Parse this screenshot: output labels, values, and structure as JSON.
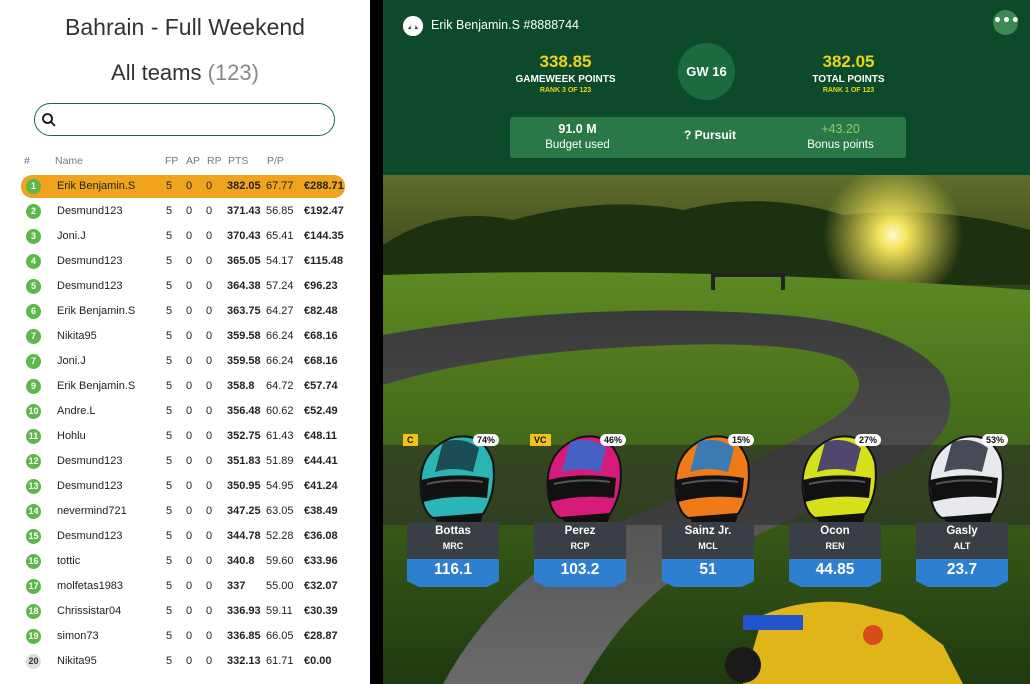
{
  "left": {
    "title": "Bahrain - Full Weekend",
    "subtitle": "All teams",
    "subtitle_count": "(123)",
    "search_placeholder": "",
    "columns": {
      "rank": "#",
      "name": "Name",
      "fp": "FP",
      "ap": "AP",
      "rp": "RP",
      "pts": "PTS",
      "pp": "P/P"
    },
    "rows": [
      {
        "rank": "1",
        "name": "Erik Benjamin.S",
        "fp": "5",
        "ap": "0",
        "rp": "0",
        "pts": "382.05",
        "pp": "67.77",
        "prize": "€288.71",
        "me": true
      },
      {
        "rank": "2",
        "name": "Desmund123",
        "fp": "5",
        "ap": "0",
        "rp": "0",
        "pts": "371.43",
        "pp": "56.85",
        "prize": "€192.47"
      },
      {
        "rank": "3",
        "name": "Joni.J",
        "fp": "5",
        "ap": "0",
        "rp": "0",
        "pts": "370.43",
        "pp": "65.41",
        "prize": "€144.35"
      },
      {
        "rank": "4",
        "name": "Desmund123",
        "fp": "5",
        "ap": "0",
        "rp": "0",
        "pts": "365.05",
        "pp": "54.17",
        "prize": "€115.48"
      },
      {
        "rank": "5",
        "name": "Desmund123",
        "fp": "5",
        "ap": "0",
        "rp": "0",
        "pts": "364.38",
        "pp": "57.24",
        "prize": "€96.23"
      },
      {
        "rank": "6",
        "name": "Erik Benjamin.S",
        "fp": "5",
        "ap": "0",
        "rp": "0",
        "pts": "363.75",
        "pp": "64.27",
        "prize": "€82.48"
      },
      {
        "rank": "7",
        "name": "Nikita95",
        "fp": "5",
        "ap": "0",
        "rp": "0",
        "pts": "359.58",
        "pp": "66.24",
        "prize": "€68.16"
      },
      {
        "rank": "7",
        "name": "Joni.J",
        "fp": "5",
        "ap": "0",
        "rp": "0",
        "pts": "359.58",
        "pp": "66.24",
        "prize": "€68.16"
      },
      {
        "rank": "9",
        "name": "Erik Benjamin.S",
        "fp": "5",
        "ap": "0",
        "rp": "0",
        "pts": "358.8",
        "pp": "64.72",
        "prize": "€57.74"
      },
      {
        "rank": "10",
        "name": "Andre.L",
        "fp": "5",
        "ap": "0",
        "rp": "0",
        "pts": "356.48",
        "pp": "60.62",
        "prize": "€52.49"
      },
      {
        "rank": "11",
        "name": "Hohlu",
        "fp": "5",
        "ap": "0",
        "rp": "0",
        "pts": "352.75",
        "pp": "61.43",
        "prize": "€48.11"
      },
      {
        "rank": "12",
        "name": "Desmund123",
        "fp": "5",
        "ap": "0",
        "rp": "0",
        "pts": "351.83",
        "pp": "51.89",
        "prize": "€44.41"
      },
      {
        "rank": "13",
        "name": "Desmund123",
        "fp": "5",
        "ap": "0",
        "rp": "0",
        "pts": "350.95",
        "pp": "54.95",
        "prize": "€41.24"
      },
      {
        "rank": "14",
        "name": "nevermind721",
        "fp": "5",
        "ap": "0",
        "rp": "0",
        "pts": "347.25",
        "pp": "63.05",
        "prize": "€38.49"
      },
      {
        "rank": "15",
        "name": "Desmund123",
        "fp": "5",
        "ap": "0",
        "rp": "0",
        "pts": "344.78",
        "pp": "52.28",
        "prize": "€36.08"
      },
      {
        "rank": "16",
        "name": "tottic",
        "fp": "5",
        "ap": "0",
        "rp": "0",
        "pts": "340.8",
        "pp": "59.60",
        "prize": "€33.96"
      },
      {
        "rank": "17",
        "name": "molfetas1983",
        "fp": "5",
        "ap": "0",
        "rp": "0",
        "pts": "337",
        "pp": "55.00",
        "prize": "€32.07"
      },
      {
        "rank": "18",
        "name": "Chrissistar04",
        "fp": "5",
        "ap": "0",
        "rp": "0",
        "pts": "336.93",
        "pp": "59.11",
        "prize": "€30.39"
      },
      {
        "rank": "19",
        "name": "simon73",
        "fp": "5",
        "ap": "0",
        "rp": "0",
        "pts": "336.85",
        "pp": "66.05",
        "prize": "€28.87"
      },
      {
        "rank": "20",
        "name": "Nikita95",
        "fp": "5",
        "ap": "0",
        "rp": "0",
        "pts": "332.13",
        "pp": "61.71",
        "prize": "€0.00",
        "grey": true
      }
    ]
  },
  "right": {
    "user_name": "Erik Benjamin.S #8888744",
    "menu_icon": "ellipsis-icon",
    "gameweek_points": "338.85",
    "gameweek_label": "GAMEWEEK POINTS",
    "gameweek_rank": "RANK 3 OF 123",
    "gw": "GW 16",
    "total_points": "382.05",
    "total_label": "TOTAL POINTS",
    "total_rank": "RANK 1 OF 123",
    "budget_value": "91.0 M",
    "budget_label": "Budget used",
    "pursuit_label": "?  Pursuit",
    "bonus_value": "+43.20",
    "bonus_label": "Bonus points",
    "colors": {
      "accent_green": "#0c4a2b",
      "gold": "#e8d51b",
      "blue": "#2f7fd0",
      "highlight": "#f0a41e"
    },
    "drivers": [
      {
        "name": "Bottas",
        "team": "MRC",
        "price": "116.1",
        "pct": "74%",
        "role": "C",
        "c1": "#2bb5b5",
        "c2": "#1a3a44"
      },
      {
        "name": "Perez",
        "team": "RCP",
        "price": "103.2",
        "pct": "46%",
        "role": "VC",
        "c1": "#d61c7a",
        "c2": "#2a6fd0"
      },
      {
        "name": "Sainz Jr.",
        "team": "MCL",
        "price": "51",
        "pct": "15%",
        "role": "",
        "c1": "#f07a1a",
        "c2": "#1c7ad0"
      },
      {
        "name": "Ocon",
        "team": "REN",
        "price": "44.85",
        "pct": "27%",
        "role": "",
        "c1": "#d6e01a",
        "c2": "#3a2a7a"
      },
      {
        "name": "Gasly",
        "team": "ALT",
        "price": "23.7",
        "pct": "53%",
        "role": "",
        "c1": "#e8e8ef",
        "c2": "#2a2f3a"
      }
    ]
  }
}
